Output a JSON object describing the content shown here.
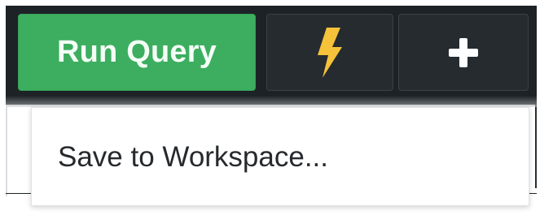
{
  "toolbar": {
    "run_query_label": "Run Query",
    "bolt_icon": "lightning-bolt-icon",
    "add_icon": "plus-icon"
  },
  "dropdown": {
    "items": [
      {
        "label": "Save to Workspace..."
      }
    ]
  },
  "colors": {
    "toolbar_bg": "#1d2226",
    "run_button": "#3dae60",
    "bolt": "#f5c23a",
    "plus": "#ffffff"
  }
}
